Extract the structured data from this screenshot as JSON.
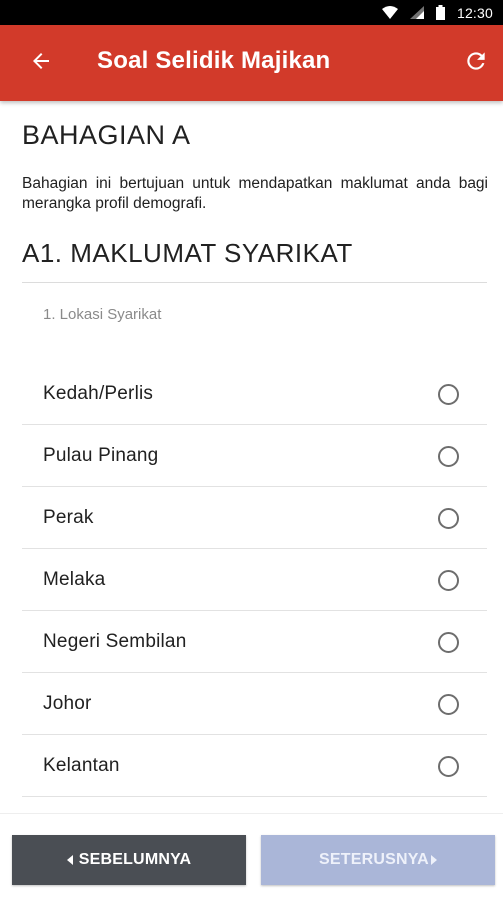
{
  "status_bar": {
    "time": "12:30",
    "icons": [
      "wifi-icon",
      "signal-icon",
      "battery-icon"
    ]
  },
  "app_bar": {
    "title": "Soal Selidik Majikan",
    "back_icon": "arrow-left-icon",
    "refresh_icon": "refresh-icon",
    "color": "#d23a2a"
  },
  "section": {
    "title": "BAHAGIAN A",
    "description": "Bahagian ini bertujuan untuk mendapatkan maklumat anda bagi merangka profil demografi.",
    "subsection_title": "A1. MAKLUMAT SYARIKAT"
  },
  "question": {
    "label": "1. Lokasi Syarikat",
    "options": [
      {
        "label": "Kedah/Perlis",
        "selected": false
      },
      {
        "label": "Pulau Pinang",
        "selected": false
      },
      {
        "label": "Perak",
        "selected": false
      },
      {
        "label": "Melaka",
        "selected": false
      },
      {
        "label": "Negeri Sembilan",
        "selected": false
      },
      {
        "label": "Johor",
        "selected": false
      },
      {
        "label": "Kelantan",
        "selected": false
      }
    ]
  },
  "navigation": {
    "prev_label": "SEBELUMNYA",
    "next_label": "SETERUSNYA",
    "prev_color": "#4a4e54",
    "next_color": "#aab6d8",
    "next_enabled": false
  }
}
